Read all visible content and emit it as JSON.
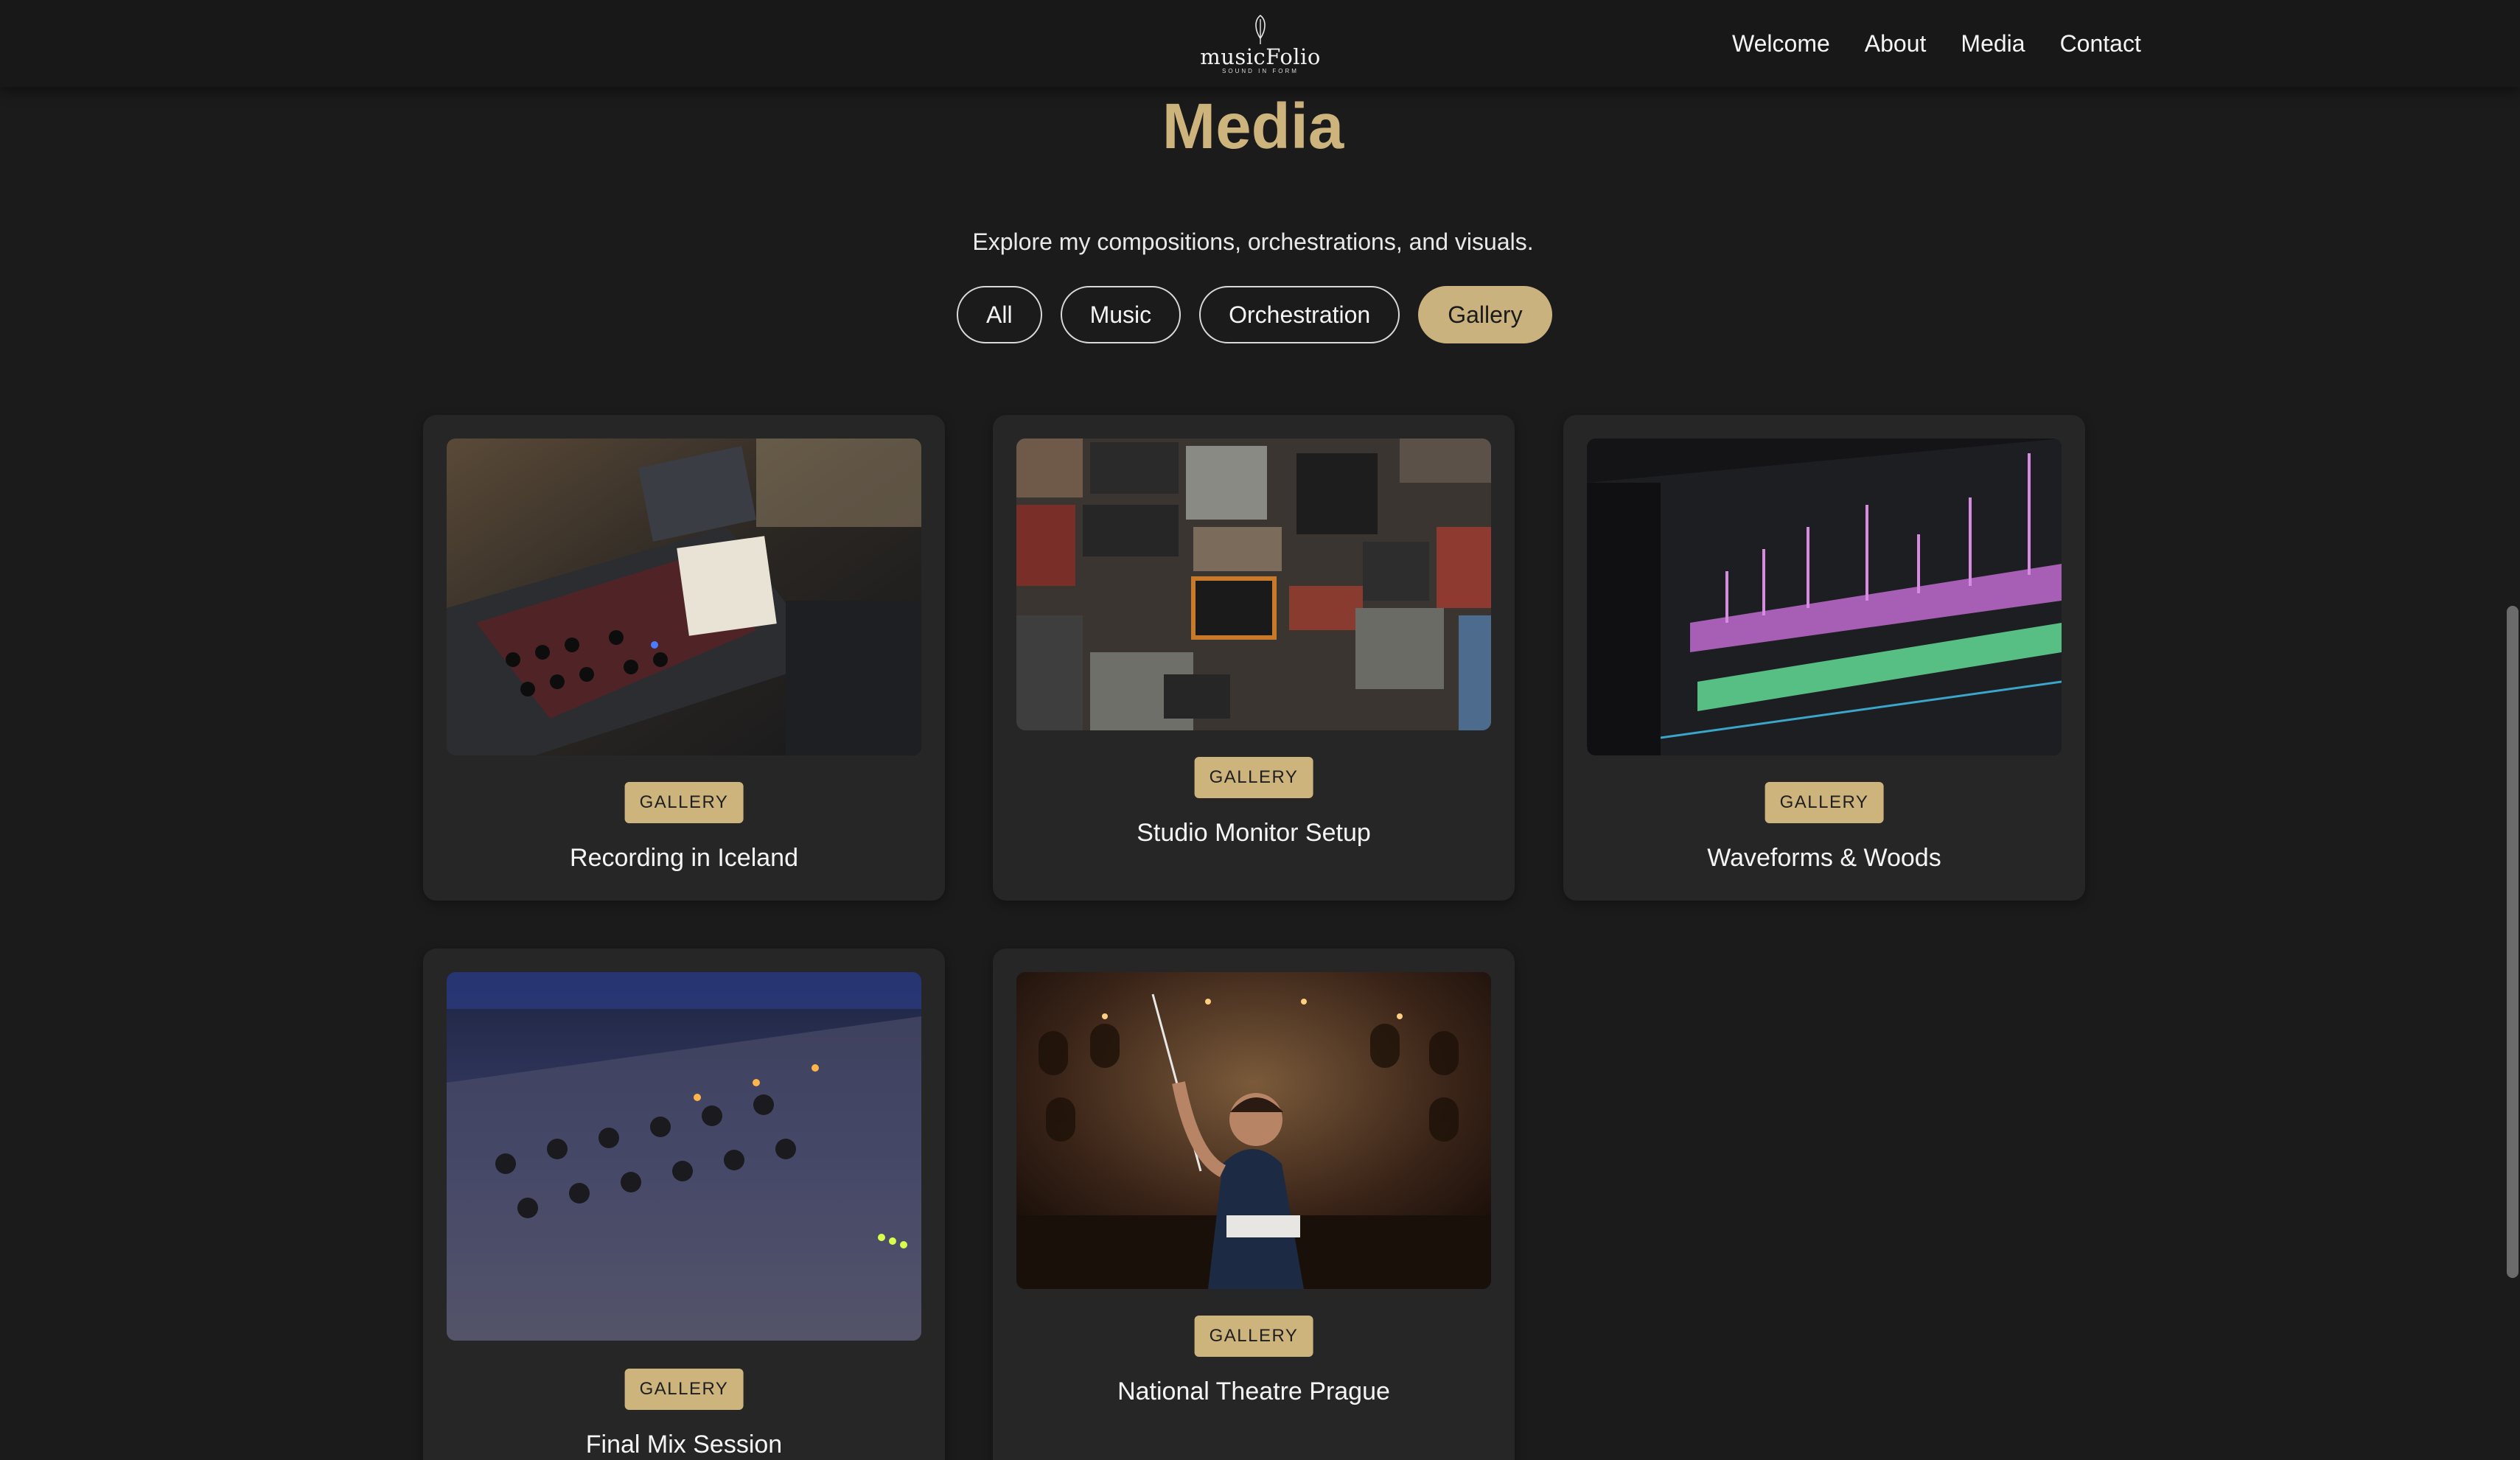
{
  "brand": {
    "name": "musicFolio",
    "tagline": "SOUND IN FORM",
    "mark_icon": "quill-leaf-icon"
  },
  "nav": {
    "items": [
      "Welcome",
      "About",
      "Media",
      "Contact"
    ]
  },
  "hero": {
    "title": "Media",
    "subtitle": "Explore my compositions, orchestrations, and visuals."
  },
  "filters": {
    "items": [
      "All",
      "Music",
      "Orchestration",
      "Gallery"
    ],
    "active": "Gallery"
  },
  "cards": [
    {
      "badge": "GALLERY",
      "title": "Recording in Iceland",
      "image": "studio-mixing-desk-photo"
    },
    {
      "badge": "GALLERY",
      "title": "Studio Monitor Setup",
      "image": "amplifier-wall-photo"
    },
    {
      "badge": "GALLERY",
      "title": "Waveforms & Woods",
      "image": "daw-waveform-screen-photo"
    },
    {
      "badge": "GALLERY",
      "title": "Final Mix Session",
      "image": "mixing-console-closeup-photo"
    },
    {
      "badge": "GALLERY",
      "title": "National Theatre Prague",
      "image": "conductor-orchestra-photo"
    }
  ],
  "colors": {
    "accent": "#cdb37c",
    "background": "#1b1b1b",
    "card": "#262626",
    "header": "#181818"
  }
}
